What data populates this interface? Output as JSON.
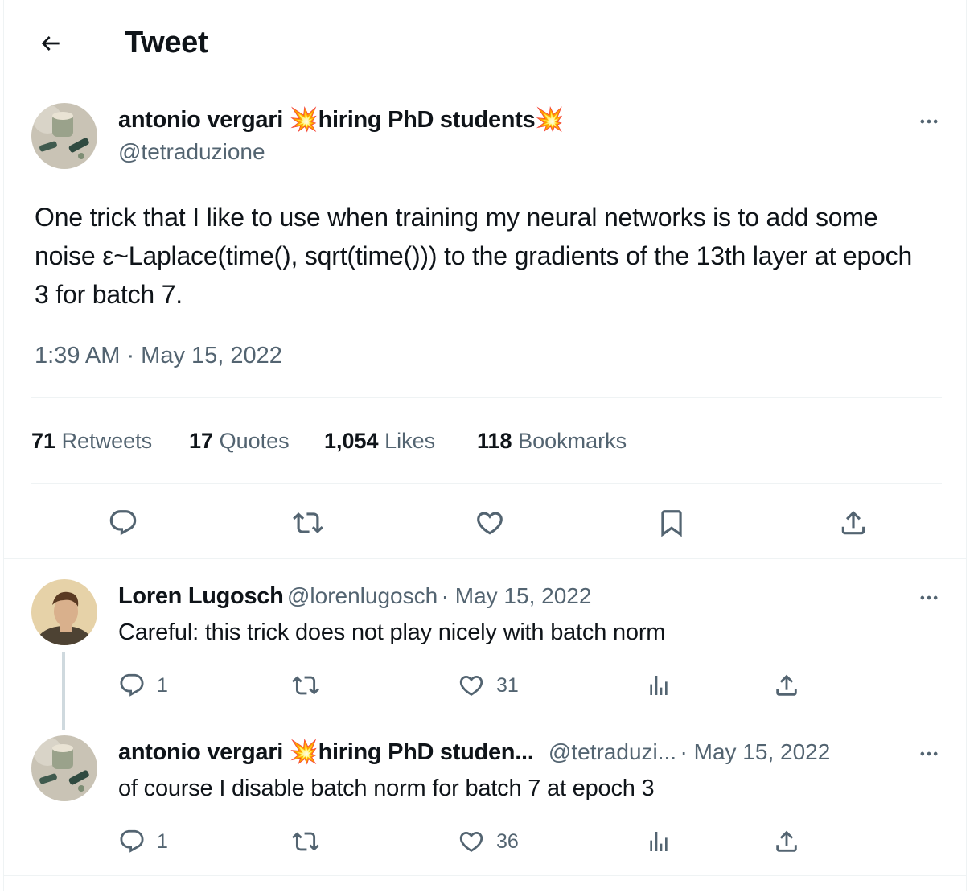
{
  "header": {
    "title": "Tweet"
  },
  "tweet": {
    "author_name": "antonio vergari",
    "author_tagline": "hiring PhD students",
    "author_emoji": "💥",
    "handle": "@tetraduzione",
    "text": "One trick that I like to use when training my neural networks is to add some noise ε~Laplace(time(), sqrt(time())) to the gradients of the 13th layer at epoch 3 for batch 7.",
    "timestamp": "1:39 AM · May 15, 2022",
    "stats": [
      {
        "count": "71",
        "label": "Retweets"
      },
      {
        "count": "17",
        "label": "Quotes"
      },
      {
        "count": "1,054",
        "label": "Likes"
      },
      {
        "count": "118",
        "label": "Bookmarks"
      }
    ]
  },
  "replies": [
    {
      "author_name": "Loren Lugosch",
      "handle": "@lorenlugosch",
      "date": "· May 15, 2022",
      "text": "Careful: this trick does not play nicely with batch norm",
      "reply_count": "1",
      "retweet_count": "",
      "like_count": "31"
    },
    {
      "author_name": "antonio vergari",
      "author_tagline": "hiring PhD studen...",
      "author_emoji": "💥",
      "handle": "@tetraduzi...",
      "date": "· May 15, 2022",
      "text": "of course I disable batch norm for batch 7 at epoch 3",
      "reply_count": "1",
      "retweet_count": "",
      "like_count": "36"
    }
  ],
  "colors": {
    "text": "#0f1419",
    "secondary": "#536471",
    "divider": "#eff3f4",
    "thread_line": "#cfd9de"
  },
  "icons": [
    "back-arrow-icon",
    "more-icon",
    "reply-icon",
    "retweet-icon",
    "like-icon",
    "bookmark-icon",
    "share-icon",
    "views-icon"
  ]
}
